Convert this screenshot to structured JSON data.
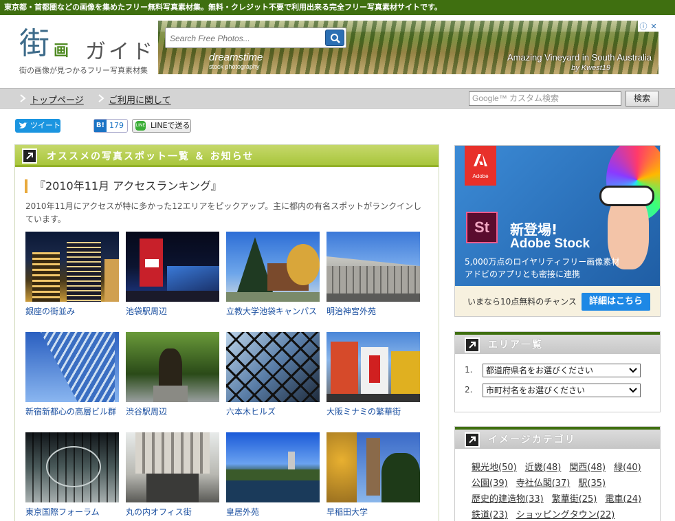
{
  "topbar": {
    "text": "東京都・首都圏などの画像を集めたフリー無料写真素材集。無料・クレジット不要で利用出来る完全フリー写真素材サイトです。"
  },
  "logo": {
    "kanji": "街",
    "sub": "画",
    "guide": "ガイド",
    "tagline": "街の画像が見つかるフリー写真素材集"
  },
  "header_ad": {
    "search_placeholder": "Search Free Photos...",
    "brand": "dreamstime",
    "brand_sub": "stock photography",
    "caption": "Amazing Vineyard in South Australia",
    "credit": "by Kwest19"
  },
  "nav": {
    "items": [
      {
        "label": "トップページ"
      },
      {
        "label": "ご利用に関して"
      }
    ],
    "search_placeholder": "Google™ カスタム検索",
    "search_button": "検索"
  },
  "social": {
    "tweet": "ツイート",
    "hatena_label": "B!",
    "hatena_count": "179",
    "line": "LINEで送る",
    "line_icon": "LINE"
  },
  "main": {
    "heading": "オススメの写真スポット一覧 ＆ お知らせ",
    "article_title": "『2010年11月 アクセスランキング』",
    "article_lead": "2010年11月にアクセスが特に多かった12エリアをピックアップ。主に都内の有名スポットがランクインしています。",
    "items": [
      {
        "caption": "銀座の街並み"
      },
      {
        "caption": "池袋駅周辺"
      },
      {
        "caption": "立教大学池袋キャンパス"
      },
      {
        "caption": "明治神宮外苑"
      },
      {
        "caption": "新宿新都心の高層ビル群"
      },
      {
        "caption": "渋谷駅周辺"
      },
      {
        "caption": "六本木ヒルズ"
      },
      {
        "caption": "大阪ミナミの繁華街"
      },
      {
        "caption": "東京国際フォーラム"
      },
      {
        "caption": "丸の内オフィス街"
      },
      {
        "caption": "皇居外苑"
      },
      {
        "caption": "早稲田大学"
      }
    ]
  },
  "side_ad": {
    "brand": "Adobe",
    "product_abbr": "St",
    "headline1": "新登場!",
    "headline2": "Adobe Stock",
    "line1": "5,000万点のロイヤリティフリー画像素材",
    "line2": "アドビのアプリとも密接に連携",
    "footer_text": "いまなら10点無料のチャンス",
    "cta": "詳細はこちら"
  },
  "area_box": {
    "heading": "エリア一覧",
    "rows": [
      {
        "num": "1.",
        "value": "都道府県名をお選びください"
      },
      {
        "num": "2.",
        "value": "市町村名をお選びください"
      }
    ]
  },
  "category_box": {
    "heading": "イメージカテゴリ",
    "links": [
      {
        "label": "観光地(50)"
      },
      {
        "label": "近畿(48)"
      },
      {
        "label": "関西(48)"
      },
      {
        "label": "緑(40)"
      },
      {
        "label": "公園(39)"
      },
      {
        "label": "寺社仏閣(37)"
      },
      {
        "label": "駅(35)"
      },
      {
        "label": "歴史的建造物(33)"
      },
      {
        "label": "繁華街(25)"
      },
      {
        "label": "電車(24)"
      },
      {
        "label": "鉄道(23)"
      },
      {
        "label": "ショッピングタウン(22)"
      }
    ]
  },
  "colors": {
    "topbar": "#3f6f10",
    "panel_head": "#a9c63c",
    "accent_link": "#1a4fa0",
    "ad_blue": "#1e88e5"
  }
}
